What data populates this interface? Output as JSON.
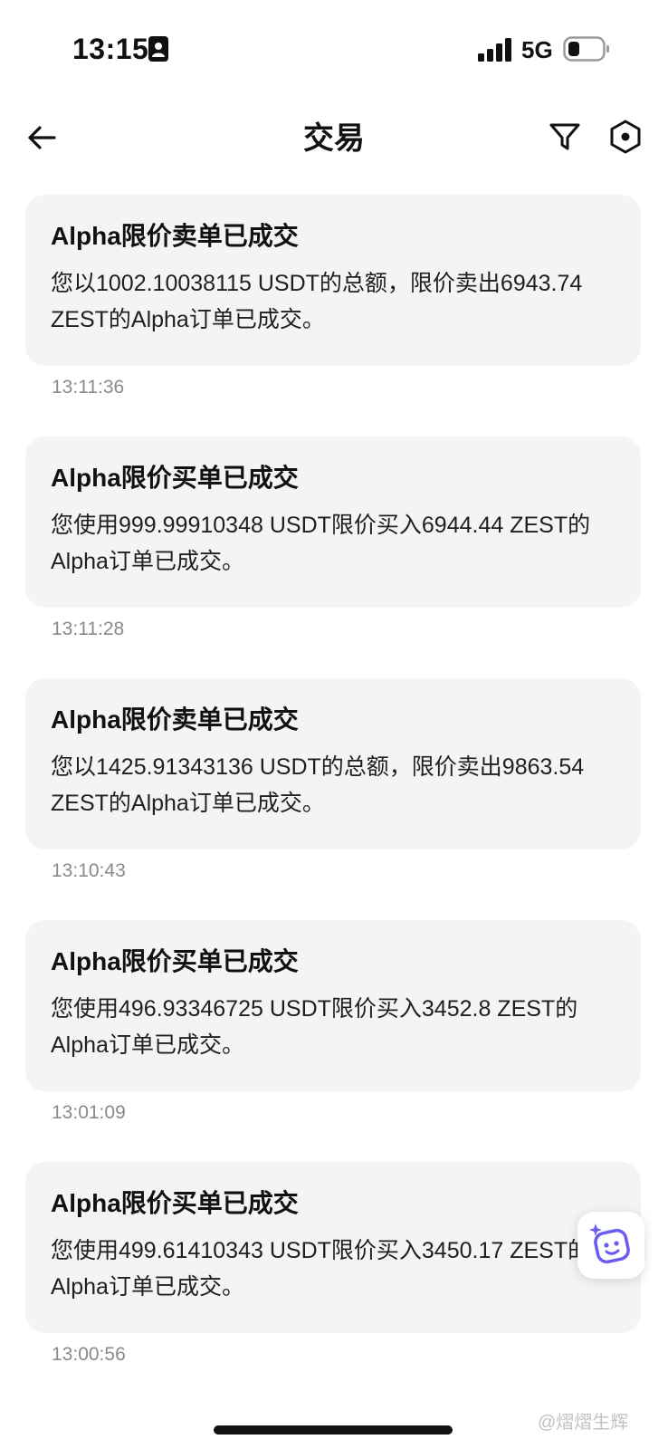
{
  "status_bar": {
    "time": "13:15",
    "network": "5G",
    "icons": [
      "contact-card-icon",
      "signal-icon",
      "battery-icon"
    ]
  },
  "header": {
    "title": "交易",
    "icons": [
      "back-arrow-icon",
      "filter-icon",
      "settings-hex-icon"
    ]
  },
  "notifications": [
    {
      "title": "Alpha限价卖单已成交",
      "body": "您以1002.10038115 USDT的总额，限价卖出6943.74 ZEST的Alpha订单已成交。",
      "time": "13:11:36"
    },
    {
      "title": "Alpha限价买单已成交",
      "body": "您使用999.99910348 USDT限价买入6944.44 ZEST的Alpha订单已成交。",
      "time": "13:11:28"
    },
    {
      "title": "Alpha限价卖单已成交",
      "body": "您以1425.91343136 USDT的总额，限价卖出9863.54 ZEST的Alpha订单已成交。",
      "time": "13:10:43"
    },
    {
      "title": "Alpha限价买单已成交",
      "body": "您使用496.93346725 USDT限价买入3452.8 ZEST的Alpha订单已成交。",
      "time": "13:01:09"
    },
    {
      "title": "Alpha限价买单已成交",
      "body": "您使用499.61410343 USDT限价买入3450.17 ZEST的Alpha订单已成交。",
      "time": "13:00:56"
    }
  ],
  "assistant": {
    "icon": "ai-assistant-face-icon",
    "color": "#6a5cf0"
  },
  "watermark": {
    "text": "@熠熠生辉"
  },
  "colors": {
    "card_bg": "#f4f4f4",
    "time_text": "#8a8a8a"
  }
}
